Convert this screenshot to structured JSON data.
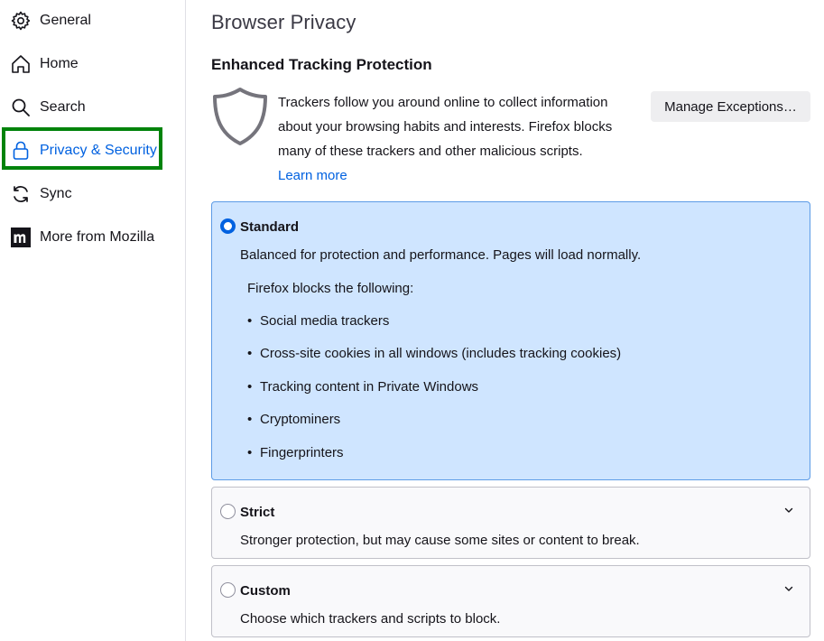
{
  "sidebar": {
    "items": [
      {
        "label": "General",
        "icon": "gear-icon"
      },
      {
        "label": "Home",
        "icon": "home-icon"
      },
      {
        "label": "Search",
        "icon": "search-icon"
      },
      {
        "label": "Privacy & Security",
        "icon": "lock-icon",
        "selected": true
      },
      {
        "label": "Sync",
        "icon": "sync-icon"
      },
      {
        "label": "More from Mozilla",
        "icon": "mozilla-logo-icon"
      }
    ]
  },
  "main": {
    "page_title": "Browser Privacy",
    "etp": {
      "section_title": "Enhanced Tracking Protection",
      "description": "Trackers follow you around online to collect information about your browsing habits and interests. Firefox blocks many of these trackers and other malicious scripts.",
      "learn_more": "Learn more",
      "manage_exceptions": "Manage Exceptions…"
    },
    "options": {
      "standard": {
        "title": "Standard",
        "description": "Balanced for protection and performance. Pages will load normally.",
        "blocks_heading": "Firefox blocks the following:",
        "blocks": [
          "Social media trackers",
          "Cross-site cookies in all windows (includes tracking cookies)",
          "Tracking content in Private Windows",
          "Cryptominers",
          "Fingerprinters"
        ]
      },
      "strict": {
        "title": "Strict",
        "description": "Stronger protection, but may cause some sites or content to break."
      },
      "custom": {
        "title": "Custom",
        "description": "Choose which trackers and scripts to block."
      }
    }
  },
  "colors": {
    "accent": "#0061e0",
    "selected_card": "#cfe5ff",
    "focus_ring": "#00830b"
  }
}
